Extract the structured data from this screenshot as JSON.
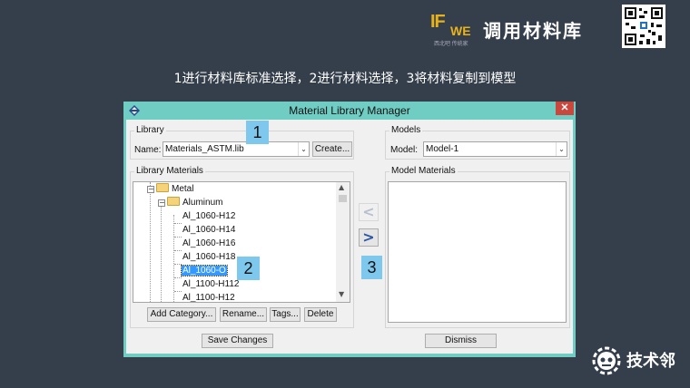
{
  "slide": {
    "title": "1进行材料库标准选择，2进行材料选择，3将材料复制到模型",
    "brand_logo_text_main": "IF",
    "brand_logo_text_sub": "WE",
    "brand_logo_tagline": "西北吧 传统家",
    "brand_title": "调用材料库",
    "footer_brand": "技术邻"
  },
  "window": {
    "title": "Material Library Manager",
    "close_label": "✕",
    "library_group": {
      "label": "Library",
      "name_label": "Name:",
      "name_value": "Materials_ASTM.lib",
      "create_button": "Create..."
    },
    "models_group": {
      "label": "Models",
      "model_label": "Model:",
      "model_value": "Model-1"
    },
    "library_materials": {
      "label": "Library Materials",
      "tree": [
        {
          "label": "Metal",
          "level": 0,
          "folder": true
        },
        {
          "label": "Aluminum",
          "level": 1,
          "folder": true
        },
        {
          "label": "Al_1060-H12",
          "level": 2
        },
        {
          "label": "Al_1060-H14",
          "level": 2
        },
        {
          "label": "Al_1060-H16",
          "level": 2
        },
        {
          "label": "Al_1060-H18",
          "level": 2
        },
        {
          "label": "Al_1060-O",
          "level": 2,
          "selected": true
        },
        {
          "label": "Al_1100-H112",
          "level": 2
        },
        {
          "label": "Al_1100-H12",
          "level": 2
        }
      ],
      "buttons": [
        "Add Category...",
        "Rename...",
        "Tags...",
        "Delete"
      ]
    },
    "model_materials": {
      "label": "Model Materials"
    },
    "copy_left_label": "<",
    "copy_right_label": ">",
    "save_button": "Save Changes",
    "dismiss_button": "Dismiss"
  },
  "annotations": {
    "badge_1": "1",
    "badge_2": "2",
    "badge_3": "3"
  },
  "colors": {
    "background": "#353e4b",
    "window_frame": "#6fcdc3",
    "badge": "#7fc8ed",
    "selection": "#3399ff",
    "close_button": "#c9473c"
  }
}
